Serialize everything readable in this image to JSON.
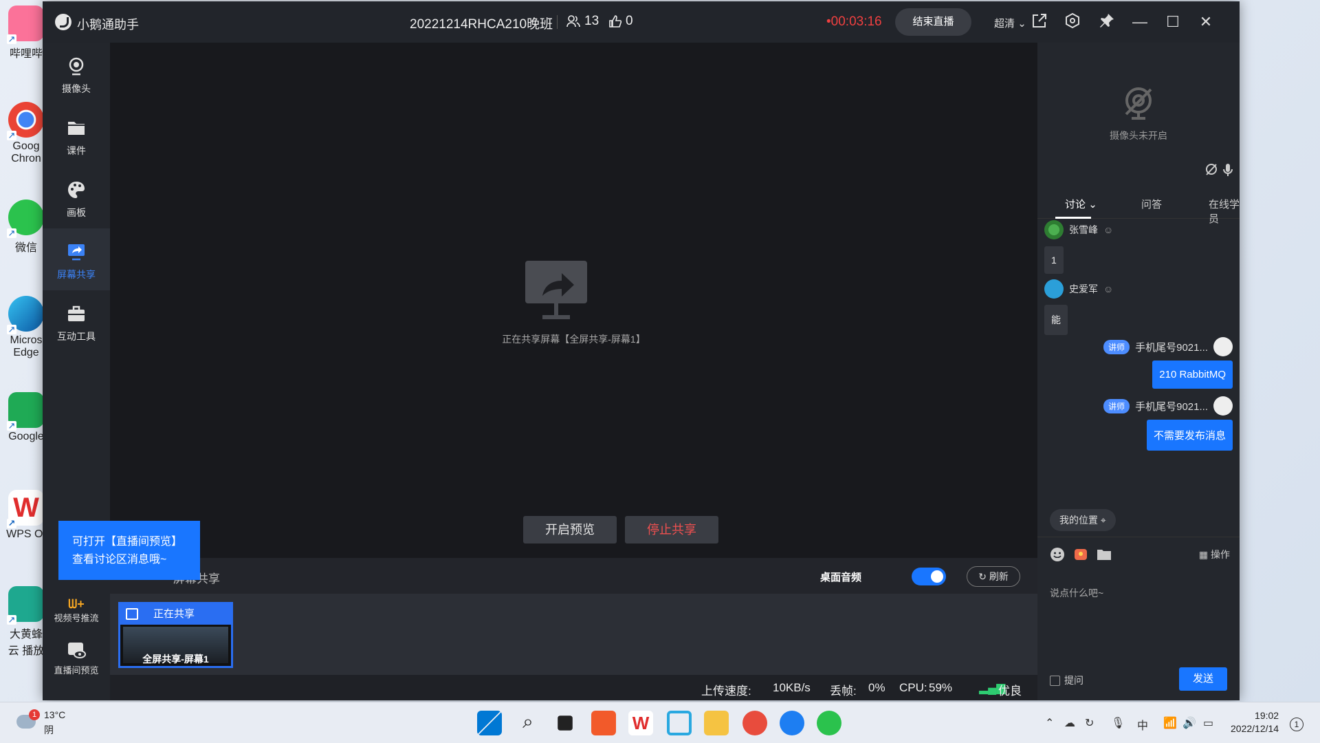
{
  "desktop": {
    "icons": [
      {
        "label": "哔哩哔",
        "color": "#fb7299"
      },
      {
        "label": "Goog Chron",
        "color": "#4285f4"
      },
      {
        "label": "微信",
        "color": "#2bc24d"
      },
      {
        "label": "Micros Edge",
        "color": "#0c8fd6"
      },
      {
        "label": "Google",
        "color": "#1faa55"
      },
      {
        "label": "WPS Of",
        "color": "#e02d2d"
      },
      {
        "label": "大黄蜂云 播放",
        "color": "#1ea88f"
      }
    ]
  },
  "app": {
    "name": "小鹅通助手",
    "class_name": "20221214RHCA210晚班",
    "people_count": "13",
    "likes_count": "0",
    "timer": "•00:03:16",
    "end_live_label": "结束直播",
    "quality_label": "超清",
    "quality_chevron": "⌄"
  },
  "nav": {
    "items": [
      {
        "label": "摄像头",
        "icon": "camera-icon"
      },
      {
        "label": "课件",
        "icon": "folder-icon"
      },
      {
        "label": "画板",
        "icon": "palette-icon"
      },
      {
        "label": "屏幕共享",
        "icon": "screen-share-icon"
      },
      {
        "label": "互动工具",
        "icon": "toolbox-icon"
      }
    ],
    "video_push_label": "视频号推流",
    "live_preview_label": "直播间预览"
  },
  "stage": {
    "sharing_text": "正在共享屏幕【全屏共享-屏幕1】",
    "preview_button": "开启预览",
    "stop_button": "停止共享"
  },
  "source_bar": {
    "tab_label": "屏幕共享",
    "desktop_audio_label": "桌面音频",
    "desktop_audio_on": true,
    "refresh_label": "刷新"
  },
  "thumb": {
    "status": "正在共享",
    "label": "全屏共享-屏幕1"
  },
  "tip": {
    "line1": "可打开【直播间预览】",
    "line2": "查看讨论区消息哦~"
  },
  "status": {
    "upload_label": "上传速度:",
    "upload_value": "10KB/s",
    "drop_label": "丢帧:",
    "drop_value": "0%",
    "cpu_label": "CPU:",
    "cpu_value": "59%",
    "network": "优良"
  },
  "right": {
    "camera_off_label": "摄像头未开启",
    "tabs": [
      "讨论",
      "问答",
      "在线学员"
    ],
    "messages": [
      {
        "user": "张雪峰",
        "text": "1"
      },
      {
        "user": "史爱军",
        "text": "能"
      },
      {
        "badge": "讲师",
        "user": "手机尾号9021...",
        "text": "210 RabbitMQ"
      },
      {
        "badge": "讲师",
        "user": "手机尾号9021...",
        "text": "不需要发布消息"
      }
    ],
    "location_label": "我的位置",
    "ops_label": "操作",
    "input_placeholder": "说点什么吧~",
    "ask_label": "提问",
    "send_label": "发送"
  },
  "taskbar": {
    "weather_temp": "13°C",
    "weather_desc": "阴",
    "weather_alert": "1",
    "ime": "中",
    "time": "19:02",
    "date": "2022/12/14",
    "notifications": "1"
  }
}
